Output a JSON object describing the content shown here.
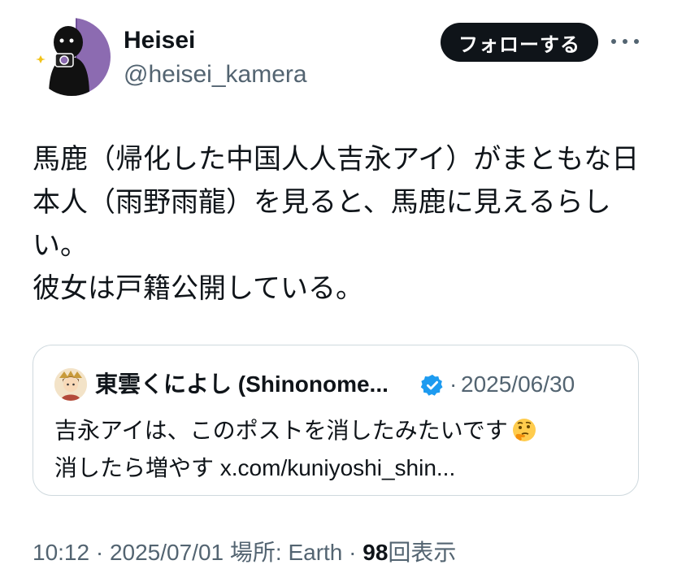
{
  "user": {
    "name": "Heisei",
    "handle": "@heisei_kamera"
  },
  "header": {
    "follow_label": "フォローする",
    "more_icon": "more-horizontal-icon"
  },
  "tweet": {
    "text": "馬鹿（帰化した中国人人吉永アイ）がまともな日本人（雨野雨龍）を見ると、馬鹿に見えるらしい。\n彼女は戸籍公開している。"
  },
  "quote": {
    "author_name": "東雲くによし (Shinonome...",
    "verified_icon": "verified-badge-icon",
    "separator": "·",
    "date": "2025/06/30",
    "text_line1": "吉永アイは、このポストを消したみたいです",
    "emoji": "thinking-face-icon",
    "text_line2": "消したら増やす x.com/kuniyoshi_shin..."
  },
  "meta": {
    "time": "10:12",
    "sep1": "·",
    "date": "2025/07/01",
    "location_label": "場所: Earth",
    "sep2": "·",
    "views_count": "98",
    "views_label": "回表示"
  },
  "colors": {
    "text": "#0f1419",
    "secondary": "#536471",
    "verified": "#1d9bf0",
    "border": "#cfd9de",
    "avatar_accent": "#8c6bb1"
  }
}
